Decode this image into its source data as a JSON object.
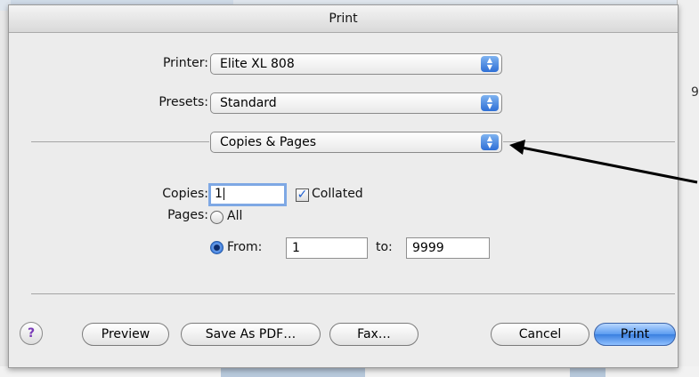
{
  "dialog": {
    "title": "Print",
    "printer_label": "Printer:",
    "printer_value": "Elite XL 808",
    "presets_label": "Presets:",
    "presets_value": "Standard",
    "section_value": "Copies & Pages",
    "copies_label": "Copies:",
    "copies_value": "1",
    "collated_label": "Collated",
    "collated_checked": true,
    "pages_label": "Pages:",
    "all_label": "All",
    "from_label": "From:",
    "from_value": "1",
    "to_label": "to:",
    "to_value": "9999",
    "selected_pages_option": "From"
  },
  "buttons": {
    "help": "?",
    "preview": "Preview",
    "save_pdf": "Save As PDF…",
    "fax": "Fax…",
    "cancel": "Cancel",
    "print": "Print"
  },
  "background": {
    "right_edge_char": "9"
  },
  "icons": {
    "popup_arrows": "updown-arrows-icon",
    "help": "question-mark-icon",
    "annotation_arrow": "arrow-icon"
  },
  "colors": {
    "accent": "#3a7fe0",
    "help_glyph": "#7a3bb8"
  }
}
